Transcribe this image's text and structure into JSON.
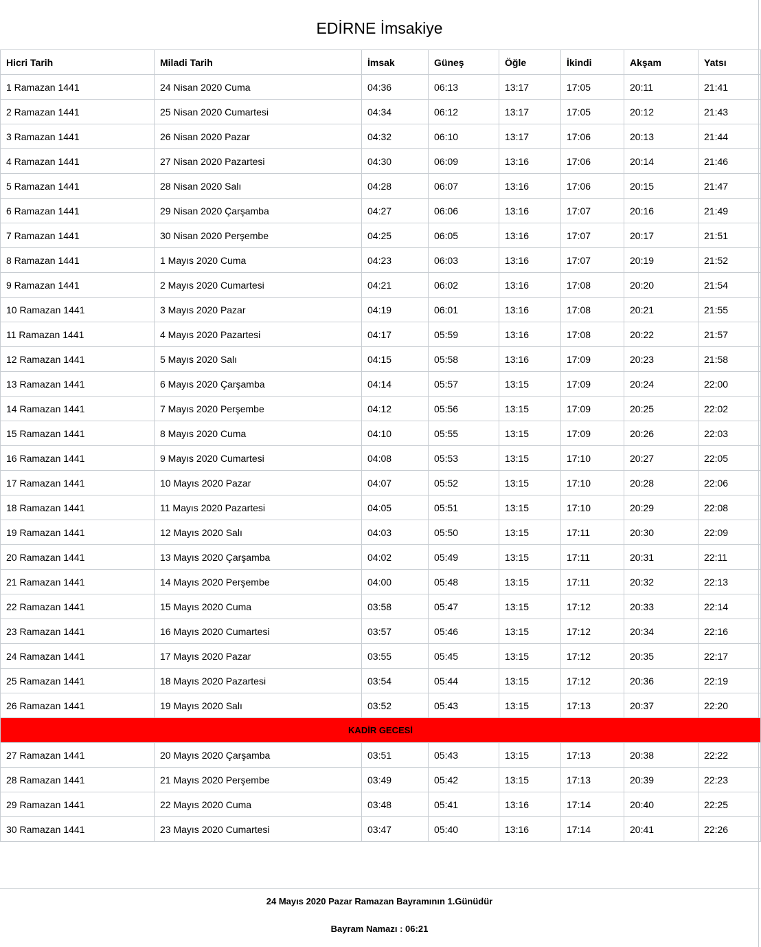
{
  "title": "EDİRNE İmsakiye",
  "headers": [
    "Hicri Tarih",
    "Miladi Tarih",
    "İmsak",
    "Güneş",
    "Öğle",
    "İkindi",
    "Akşam",
    "Yatsı"
  ],
  "rows_before": [
    [
      "1 Ramazan 1441",
      "24 Nisan 2020 Cuma",
      "04:36",
      "06:13",
      "13:17",
      "17:05",
      "20:11",
      "21:41"
    ],
    [
      "2 Ramazan 1441",
      "25 Nisan 2020 Cumartesi",
      "04:34",
      "06:12",
      "13:17",
      "17:05",
      "20:12",
      "21:43"
    ],
    [
      "3 Ramazan 1441",
      "26 Nisan 2020 Pazar",
      "04:32",
      "06:10",
      "13:17",
      "17:06",
      "20:13",
      "21:44"
    ],
    [
      "4 Ramazan 1441",
      "27 Nisan 2020 Pazartesi",
      "04:30",
      "06:09",
      "13:16",
      "17:06",
      "20:14",
      "21:46"
    ],
    [
      "5 Ramazan 1441",
      "28 Nisan 2020 Salı",
      "04:28",
      "06:07",
      "13:16",
      "17:06",
      "20:15",
      "21:47"
    ],
    [
      "6 Ramazan 1441",
      "29 Nisan 2020 Çarşamba",
      "04:27",
      "06:06",
      "13:16",
      "17:07",
      "20:16",
      "21:49"
    ],
    [
      "7 Ramazan 1441",
      "30 Nisan 2020 Perşembe",
      "04:25",
      "06:05",
      "13:16",
      "17:07",
      "20:17",
      "21:51"
    ],
    [
      "8 Ramazan 1441",
      "1 Mayıs 2020 Cuma",
      "04:23",
      "06:03",
      "13:16",
      "17:07",
      "20:19",
      "21:52"
    ],
    [
      "9 Ramazan 1441",
      "2 Mayıs 2020 Cumartesi",
      "04:21",
      "06:02",
      "13:16",
      "17:08",
      "20:20",
      "21:54"
    ],
    [
      "10 Ramazan 1441",
      "3 Mayıs 2020 Pazar",
      "04:19",
      "06:01",
      "13:16",
      "17:08",
      "20:21",
      "21:55"
    ],
    [
      "11 Ramazan 1441",
      "4 Mayıs 2020 Pazartesi",
      "04:17",
      "05:59",
      "13:16",
      "17:08",
      "20:22",
      "21:57"
    ],
    [
      "12 Ramazan 1441",
      "5 Mayıs 2020 Salı",
      "04:15",
      "05:58",
      "13:16",
      "17:09",
      "20:23",
      "21:58"
    ],
    [
      "13 Ramazan 1441",
      "6 Mayıs 2020 Çarşamba",
      "04:14",
      "05:57",
      "13:15",
      "17:09",
      "20:24",
      "22:00"
    ],
    [
      "14 Ramazan 1441",
      "7 Mayıs 2020 Perşembe",
      "04:12",
      "05:56",
      "13:15",
      "17:09",
      "20:25",
      "22:02"
    ],
    [
      "15 Ramazan 1441",
      "8 Mayıs 2020 Cuma",
      "04:10",
      "05:55",
      "13:15",
      "17:09",
      "20:26",
      "22:03"
    ],
    [
      "16 Ramazan 1441",
      "9 Mayıs 2020 Cumartesi",
      "04:08",
      "05:53",
      "13:15",
      "17:10",
      "20:27",
      "22:05"
    ],
    [
      "17 Ramazan 1441",
      "10 Mayıs 2020 Pazar",
      "04:07",
      "05:52",
      "13:15",
      "17:10",
      "20:28",
      "22:06"
    ],
    [
      "18 Ramazan 1441",
      "11 Mayıs 2020 Pazartesi",
      "04:05",
      "05:51",
      "13:15",
      "17:10",
      "20:29",
      "22:08"
    ],
    [
      "19 Ramazan 1441",
      "12 Mayıs 2020 Salı",
      "04:03",
      "05:50",
      "13:15",
      "17:11",
      "20:30",
      "22:09"
    ],
    [
      "20 Ramazan 1441",
      "13 Mayıs 2020 Çarşamba",
      "04:02",
      "05:49",
      "13:15",
      "17:11",
      "20:31",
      "22:11"
    ],
    [
      "21 Ramazan 1441",
      "14 Mayıs 2020 Perşembe",
      "04:00",
      "05:48",
      "13:15",
      "17:11",
      "20:32",
      "22:13"
    ],
    [
      "22 Ramazan 1441",
      "15 Mayıs 2020 Cuma",
      "03:58",
      "05:47",
      "13:15",
      "17:12",
      "20:33",
      "22:14"
    ],
    [
      "23 Ramazan 1441",
      "16 Mayıs 2020 Cumartesi",
      "03:57",
      "05:46",
      "13:15",
      "17:12",
      "20:34",
      "22:16"
    ],
    [
      "24 Ramazan 1441",
      "17 Mayıs 2020 Pazar",
      "03:55",
      "05:45",
      "13:15",
      "17:12",
      "20:35",
      "22:17"
    ],
    [
      "25 Ramazan 1441",
      "18 Mayıs 2020 Pazartesi",
      "03:54",
      "05:44",
      "13:15",
      "17:12",
      "20:36",
      "22:19"
    ],
    [
      "26 Ramazan 1441",
      "19 Mayıs 2020 Salı",
      "03:52",
      "05:43",
      "13:15",
      "17:13",
      "20:37",
      "22:20"
    ]
  ],
  "kadir_label": "KADİR GECESİ",
  "kadir_color": "#ff0000",
  "rows_after": [
    [
      "27 Ramazan 1441",
      "20 Mayıs 2020 Çarşamba",
      "03:51",
      "05:43",
      "13:15",
      "17:13",
      "20:38",
      "22:22"
    ],
    [
      "28 Ramazan 1441",
      "21 Mayıs 2020 Perşembe",
      "03:49",
      "05:42",
      "13:15",
      "17:13",
      "20:39",
      "22:23"
    ],
    [
      "29 Ramazan 1441",
      "22 Mayıs 2020 Cuma",
      "03:48",
      "05:41",
      "13:16",
      "17:14",
      "20:40",
      "22:25"
    ],
    [
      "30 Ramazan 1441",
      "23 Mayıs 2020 Cumartesi",
      "03:47",
      "05:40",
      "13:16",
      "17:14",
      "20:41",
      "22:26"
    ]
  ],
  "footer": {
    "bayram_note": "24 Mayıs 2020 Pazar Ramazan Bayramının 1.Günüdür",
    "bayram_namazi": "Bayram Namazı : 06:21"
  }
}
